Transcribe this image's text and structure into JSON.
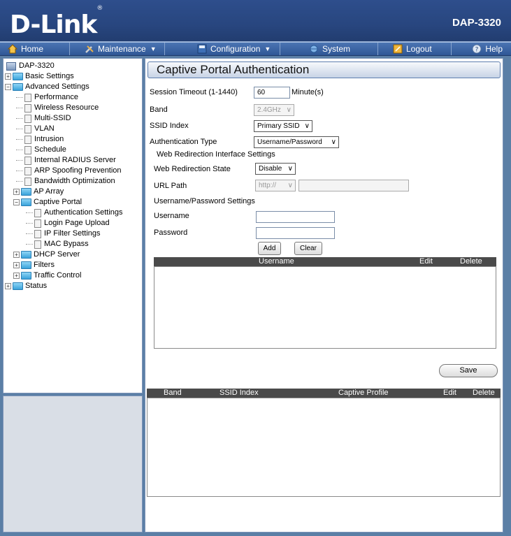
{
  "header": {
    "logo": "D-Link",
    "model": "DAP-3320"
  },
  "menu": {
    "home": "Home",
    "maintenance": "Maintenance",
    "configuration": "Configuration",
    "system": "System",
    "logout": "Logout",
    "help": "Help"
  },
  "tree": {
    "root": "DAP-3320",
    "basic_settings": "Basic Settings",
    "advanced_settings": "Advanced Settings",
    "performance": "Performance",
    "wireless_resource": "Wireless Resource",
    "multi_ssid": "Multi-SSID",
    "vlan": "VLAN",
    "intrusion": "Intrusion",
    "schedule": "Schedule",
    "internal_radius": "Internal RADIUS Server",
    "arp_spoofing": "ARP Spoofing Prevention",
    "bandwidth_opt": "Bandwidth Optimization",
    "ap_array": "AP Array",
    "captive_portal": "Captive Portal",
    "auth_settings": "Authentication Settings",
    "login_page_upload": "Login Page Upload",
    "ip_filter": "IP Filter Settings",
    "mac_bypass": "MAC Bypass",
    "dhcp_server": "DHCP Server",
    "filters": "Filters",
    "traffic_control": "Traffic Control",
    "status": "Status"
  },
  "main": {
    "title": "Captive Portal Authentication",
    "session_timeout_label": "Session Timeout (1-1440)",
    "session_timeout_value": "60",
    "minutes_label": "Minute(s)",
    "band_label": "Band",
    "band_value": "2.4GHz",
    "ssid_index_label": "SSID Index",
    "ssid_index_value": "Primary SSID",
    "auth_type_label": "Authentication Type",
    "auth_type_value": "Username/Password",
    "web_redir_section": "Web Redirection Interface Settings",
    "web_redir_state_label": "Web Redirection State",
    "web_redir_state_value": "Disable",
    "url_path_label": "URL Path",
    "url_path_protocol": "http://",
    "url_path_value": "",
    "userpass_section": "Username/Password Settings",
    "username_label": "Username",
    "username_value": "",
    "password_label": "Password",
    "password_value": "",
    "add_button": "Add",
    "clear_button": "Clear",
    "user_table_headers": [
      "Username",
      "Edit",
      "Delete"
    ],
    "save_button": "Save",
    "profile_table_headers": [
      "Band",
      "SSID Index",
      "Captive Profile",
      "Edit",
      "Delete"
    ]
  }
}
